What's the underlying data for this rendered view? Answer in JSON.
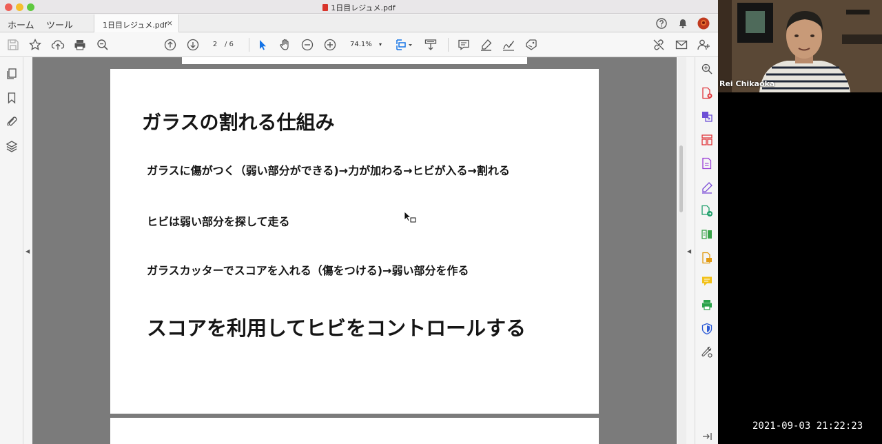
{
  "window": {
    "title": "1日目レジュメ.pdf"
  },
  "nav": {
    "home_label": "ホーム",
    "tools_label": "ツール",
    "document_tab": "1日目レジュメ.pdf",
    "close_glyph": "×"
  },
  "toolbar": {
    "current_page": "2",
    "total_pages": "/ 6",
    "zoom": "74.1%",
    "zoom_caret": "▾",
    "icons": [
      "save-icon",
      "bookmark-star-icon",
      "upload-icon",
      "print-icon",
      "zoom-out-magnifier-icon",
      "page-up-icon",
      "page-down-icon",
      "select-cursor-icon",
      "hand-icon",
      "zoom-minus-icon",
      "zoom-plus-icon",
      "page-fit-icon",
      "scroll-mode-icon",
      "comment-icon",
      "highlight-icon",
      "sign-icon",
      "stamp-icon",
      "share-link-icon",
      "mail-icon",
      "add-user-icon"
    ]
  },
  "document": {
    "slide_title": "ガラスの割れる仕組み",
    "lines": [
      "ガラスに傷がつく（弱い部分ができる)→力が加わる→ヒビが入る→割れる",
      "ヒビは弱い部分を探して走る",
      "ガラスカッターでスコアを入れる（傷をつける)→弱い部分を作る"
    ],
    "conclusion": "スコアを利用してヒビをコントロールする"
  },
  "panels": {
    "left_collapse": "◀",
    "right_collapse": "◀"
  },
  "video": {
    "participant_name": "Rei Chikaoka",
    "timestamp": "2021-09-03 21:22:23"
  },
  "colors": {
    "accent_blue": "#1473e6",
    "acrobat_red": "#d9352b",
    "viewer_gray": "#7b7b7b"
  }
}
